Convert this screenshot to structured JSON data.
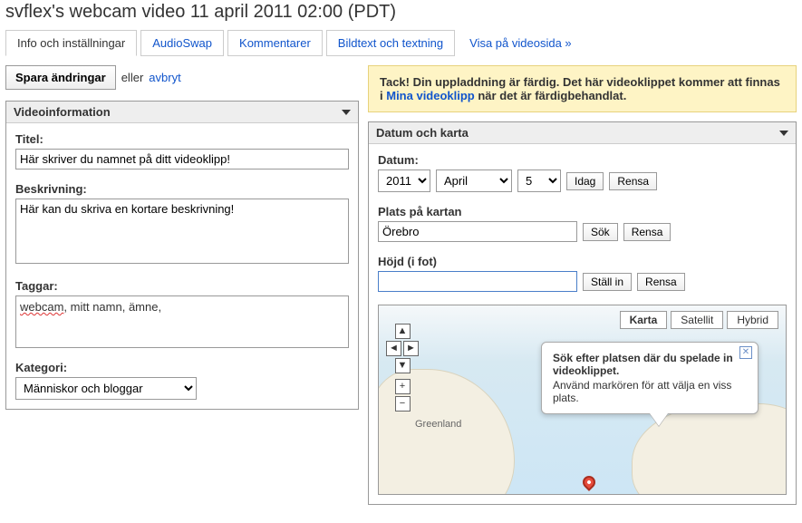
{
  "page_title": "svflex's webcam video 11 april 2011 02:00 (PDT)",
  "tabs": {
    "info": "Info och inställningar",
    "audioswap": "AudioSwap",
    "comments": "Kommentarer",
    "captions": "Bildtext och textning",
    "view_link": "Visa på videosida »"
  },
  "save": {
    "button": "Spara ändringar",
    "or": "eller",
    "cancel": "avbryt"
  },
  "notice": {
    "pre": "Tack! Din uppladdning är färdig. Det här videoklippet kommer att finnas i ",
    "link": "Mina videoklipp",
    "post": " när det är färdigbehandlat."
  },
  "videoinfo": {
    "header": "Videoinformation",
    "title_label": "Titel:",
    "title_value": "Här skriver du namnet på ditt videoklipp!",
    "desc_label": "Beskrivning:",
    "desc_value": "Här kan du skriva en kortare beskrivning!",
    "tags_label": "Taggar:",
    "tags_first": "webcam",
    "tags_rest": ", mitt namn, ämne,",
    "category_label": "Kategori:",
    "category_value": "Människor och bloggar"
  },
  "datemap": {
    "header": "Datum och karta",
    "date_label": "Datum:",
    "year": "2011",
    "month": "April",
    "day": "5",
    "today": "Idag",
    "clear": "Rensa",
    "place_label": "Plats på kartan",
    "place_value": "Örebro",
    "search": "Sök",
    "altitude_label": "Höjd (i fot)",
    "altitude_value": "",
    "set": "Ställ in"
  },
  "map": {
    "type_map": "Karta",
    "type_sat": "Satellit",
    "type_hyb": "Hybrid",
    "greenland": "Greenland",
    "tip_bold": "Sök efter platsen där du spelade in videoklippet.",
    "tip_rest": "Använd markören för att välja en viss plats."
  }
}
